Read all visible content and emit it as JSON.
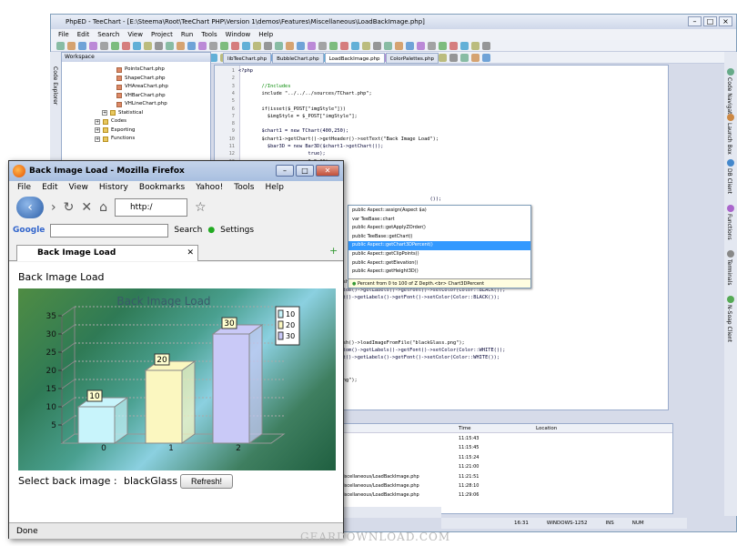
{
  "ide": {
    "title": "PhpED - TeeChart - [E:\\Steema\\Root\\TeeChart PHP\\Version 1\\demos\\Features\\Miscellaneous\\LoadBackImage.php]",
    "menu": [
      "File",
      "Edit",
      "Search",
      "View",
      "Project",
      "Run",
      "Tools",
      "Window",
      "Help"
    ],
    "workspace_title": "Workspace",
    "tree": [
      {
        "label": "PointsChart.php",
        "indent": 60
      },
      {
        "label": "ShapeChart.php",
        "indent": 60
      },
      {
        "label": "VHAreaChart.php",
        "indent": 60
      },
      {
        "label": "VHBarChart.php",
        "indent": 60
      },
      {
        "label": "VHLineChart.php",
        "indent": 60
      },
      {
        "label": "Statistical",
        "indent": 44,
        "folder": true
      },
      {
        "label": "Codes",
        "indent": 36,
        "folder": true
      },
      {
        "label": "Exporting",
        "indent": 36,
        "folder": true
      },
      {
        "label": "Functions",
        "indent": 36,
        "folder": true
      },
      {
        "label": "ThemesDemo.php",
        "indent": 44
      },
      {
        "label": "Overview",
        "indent": 36
      },
      {
        "label": "Tools",
        "indent": 36,
        "folder": true
      },
      {
        "label": "AnnotationTool.php",
        "indent": 44
      },
      {
        "label": "ColorBandTool.php",
        "indent": 44
      }
    ],
    "left_strip": "Code Explorer",
    "right_strip": [
      "Code Navigator",
      "Launch Box",
      "DB Client",
      "Functions",
      "Terminals",
      "N-Soap Client"
    ],
    "tabs": [
      "libTeeChart.php",
      "BubbleChart.php",
      "LoadBackImage.php",
      "ColorPalettes.php"
    ],
    "code": [
      {
        "n": "1",
        "t": "<?php"
      },
      {
        "n": "2",
        "t": ""
      },
      {
        "n": "3",
        "t": "        //Includes"
      },
      {
        "n": "4",
        "t": "        include \"../../../sources/TChart.php\";"
      },
      {
        "n": "5",
        "t": ""
      },
      {
        "n": "6",
        "t": "        if(isset($_POST[\"imgStyle\"]))"
      },
      {
        "n": "7",
        "t": "          $imgStyle = $_POST[\"imgStyle\"];"
      },
      {
        "n": "8",
        "t": ""
      },
      {
        "n": "9",
        "t": "        $chart1 = new TChart(400,250);"
      },
      {
        "n": "10",
        "t": "        $chart1->getChart()->getHeader()->setText(\"Back Image Load\");"
      },
      {
        "n": "11",
        "t": "          $bar3D = new Bar3D($chart1->getChart());"
      },
      {
        "n": "12",
        "t": "                        true);"
      },
      {
        "n": "13",
        "t": "                        0,0,\"\");"
      },
      {
        "n": "14",
        "t": "                        10,\"\");"
      },
      {
        "n": "15",
        "t": "                        0,\"\");"
      },
      {
        "n": "16",
        "t": ""
      },
      {
        "n": "17",
        "t": "                    ->"
      },
      {
        "n": "18",
        "t": "                                                                  ());"
      },
      {
        "n": "19",
        "t": ""
      },
      {
        "n": "20",
        "t": ""
      },
      {
        "n": "21",
        "t": ""
      },
      {
        "n": "22",
        "t": ""
      },
      {
        "n": "23",
        "t": ""
      },
      {
        "n": "24",
        "t": "          $chart1->getAxe                                              ng\");"
      },
      {
        "n": "25",
        "t": "          $chart1->getAxe                                           Color::WHITE());"
      },
      {
        "n": "26",
        "t": "          $chart1->getAxe"
      },
      {
        "n": "27",
        "t": "          break;"
      },
      {
        "n": "28",
        "t": ""
      },
      {
        "n": "29",
        "t": "          $chart1->getPan ()->getBrush()->loadImageFromFile(\"VistaImg.png\");"
      },
      {
        "n": "30",
        "t": "          $chart1->getAxe ()->getBottom()->getLabels()->getFont()->setColor(Color::BLACK());"
      },
      {
        "n": "31",
        "t": "          $chart1->getAxe ()->getLeft()->getLabels()->getFont()->setColor(Color::BLACK());"
      },
      {
        "n": "32",
        "t": ""
      },
      {
        "n": "33",
        "t": ""
      },
      {
        "n": "34",
        "t": ""
      },
      {
        "n": "35",
        "t": ""
      },
      {
        "n": "36",
        "t": ""
      },
      {
        "n": "37",
        "t": "          $chart1->getPan ()->getBrush()->loadImageFromFile(\"blackGlass.png\");"
      },
      {
        "n": "38",
        "t": "          $chart1->getAxe ()->getBottom()->getLabels()->getFont()->setColor(Color::WHITE());"
      },
      {
        "n": "39",
        "t": "          $chart1->getAxe ()->getLeft()->getLabels()->getFont()->setColor(Color::WHITE());"
      },
      {
        "n": "40",
        "t": ""
      },
      {
        "n": "41",
        "t": ""
      },
      {
        "n": "42",
        "t": "                     ender(\"chart1.png\");"
      }
    ],
    "autocomplete": [
      "public   Aspect::assign(Aspect $a)",
      "var   TeeBase::chart",
      "public   Aspect::getApplyZOrder()",
      "public   TeeBase::getChart()",
      "public   Aspect::getChart3DPercent()",
      "public   Aspect::getClipPoints()",
      "public   Aspect::getElevation()",
      "public   Aspect::getHeight3D()"
    ],
    "autocomplete_selected": 4,
    "autocomplete_tip": "Percent from 0 to 100 of Z Depth.<br> Chart3DPercent",
    "output_header": {
      "time": "Time",
      "location": "Location"
    },
    "output_rows": [
      {
        "type": "",
        "msg": "",
        "time": "11:15:43"
      },
      {
        "type": "",
        "msg": "",
        "time": "11:15:45"
      },
      {
        "type": "",
        "msg": "demos/Features/Miscellaneous/LoadBackImage.php",
        "time": "11:15:24"
      },
      {
        "type": "",
        "msg": "demos/Features/Miscellaneous/LoadBackImage.php",
        "time": "11:21:00"
      },
      {
        "type": "Action",
        "msg": "running script: http://localhost:8080/file:/E:/Steema/Root/TeeChart%20PHP/Version%201/demos/Features/Miscellaneous/LoadBackImage.php",
        "time": "11:21:51"
      },
      {
        "type": "Action",
        "msg": "running script: http://localhost:8080/file:/E:/Steema/Root/TeeChart%20PHP/Version%201/demos/Features/Miscellaneous/LoadBackImage.php",
        "time": "11:28:10"
      },
      {
        "type": "Action",
        "msg": "running script: http://localhost:8080/file:/E:/Steema/Root/TeeChart%20PHP/Version%201/demos/Features/Miscellaneous/LoadBackImage.php",
        "time": "11:29:06"
      }
    ],
    "bottom_tabs": [
      "Errors",
      "Log",
      "Search Results",
      "Transfers",
      "Breakpoints",
      "Call Stack",
      "Locals",
      "Wa...",
      "Globals"
    ],
    "status": {
      "pos": "16:31",
      "encoding": "WINDOWS-1252",
      "ins": "INS",
      "num": "NUM"
    }
  },
  "firefox": {
    "title": "Back Image Load - Mozilla Firefox",
    "menu": [
      "File",
      "Edit",
      "View",
      "History",
      "Bookmarks",
      "Yahoo!",
      "Tools",
      "Help"
    ],
    "url": "http:/",
    "search_engine": "Google",
    "search_label": "Search",
    "settings_label": "Settings",
    "tab_title": "Back Image Load",
    "page_heading": "Back Image Load",
    "select_label": "Select back image :",
    "select_value": "blackGlass",
    "refresh_label": "Refresh!",
    "status": "Done"
  },
  "chart_data": {
    "type": "bar",
    "title": "Back Image Load",
    "categories": [
      "0",
      "1",
      "2"
    ],
    "values": [
      10,
      20,
      30
    ],
    "ylim": [
      0,
      35
    ],
    "yticks": [
      5,
      10,
      15,
      20,
      25,
      30,
      35
    ],
    "legend": [
      "10",
      "20",
      "30"
    ],
    "legend_position": "top-right"
  },
  "watermark": "GEARDOWNLOAD.COM"
}
